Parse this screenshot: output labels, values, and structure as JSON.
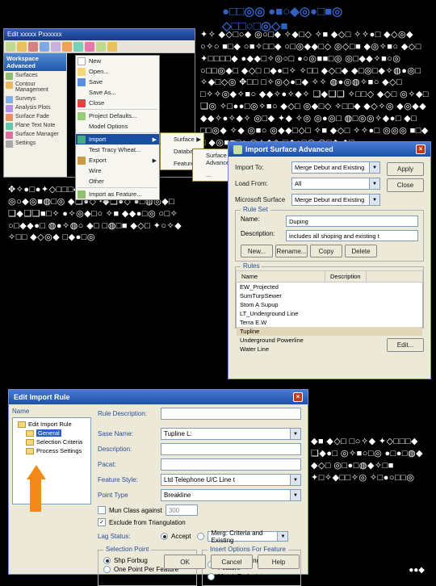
{
  "title_line1": "●□□◎◎ ●■○◆◎●□■◎",
  "title_line2": "◇□□○□◎◇■",
  "para1": "✦✧ ◆◇□○◆ ◎○□◆ ✧◆□◇ ✧■ ◆◇□ ✧✧●□ ◆◇◎◆ ○✧○ ■□◆ ○■✧□□◆ ○□◎◆◆□◇ ◎◇□■ ◆◎✧■○ ◆◇□ ✦□□□□◆ ●◆◆□✧◎○□ ●○◎■■□◎ ◎□◆◆✧■○◎ ○□□◎◆□ ◆◇□ □◆●□✧ ✧□□ ◆◇□◆ ◆□◎□◆✧◍●◎□ ✧◆□◇◎ ✥□□ □✧◎◇●□◆ ✧✧ ◍●◎◍✧■○ ◆◇□ □✧✧◎◆✧■○ ◆◆✧●✧◆✧ ❑◆❑❑ ✧□□◇ ◆◇□ ◎✧◆□ ❑◎ ✧□●●□◎✧■○ ◆◇□ ◎◆□◇ ✧□□◆ ◆◇✧◎ ◆◎◆◆ ◆◆✧●✧◆✧ ◎□◆ ✦◆ ✧◎ ◎●◎□ ◍□◎◎✧◆●□ ◆□ □□◎◆ ✧◆ ◎■○ ◎◆◆□◇□ ✧■ ◆◇□ ✧✧●□ ◎◎◎ ■□◆ □ ◆◎■■□○ ◎✧◆◇ □◆●□◎ ◎□◆ ◆□",
  "para2": "✥✧●□●✦◇□□□◆●◎◆◆□✧◎○□ ◎○◆◎■◍□◎ ◆❑●◇ •◆❑●◇ ●□◍◎◆□ ❑◆❑❑■□✧ ●✧◎◆□○ ✧■ ◆◆●□◎ ○□✧ ○□◆◆●□ ◍●✧◍○ ◆□ □◍□■ ◆◇□ ✦○✧◆ ✧□□ ◆◇◎◆ □◆●□◎",
  "para3": "◆■ ◆◇□ □○✧◆ ✦◇□□□◆ ❑◆●□ ◎✧■○□◎ ●□●□◍◆ ◆◇□ ◎□●□◍◆✧□■ ✦□✧◆□□✧◎ ✧□●○□□◎",
  "pagenum": "●●◆",
  "s1": {
    "title": "Edit xxxxx Pxxxxxx",
    "tasks_header": "Workspace Advanced",
    "sidebar_items": [
      "Surfaces",
      "Contour Management",
      "Surveys",
      "Analysis Plots",
      "Surface Fade",
      "Plane Text Note",
      "Surface Manager",
      "Settings"
    ],
    "menu_items": [
      "New",
      "Open...",
      "Save",
      "Save As...",
      "Close",
      "Project Defaults...",
      "Model Options",
      "Import",
      "Test Tracy Wheat...",
      "Export",
      "Wire",
      "Other"
    ],
    "menu_last": "Import as Feature...",
    "submenu": [
      "Surface",
      "Database",
      "Feature"
    ],
    "subsubmenu": [
      "Surface Advanced...",
      "..."
    ]
  },
  "s2": {
    "title": "Import Surface Advanced",
    "lbl_importto": "Import To:",
    "val_importto": "Merge Debut and Existing",
    "lbl_loadfrom": "Load From:",
    "val_loadfrom": "All",
    "lbl_micesurf": "Microsoft Surface",
    "val_micesurf": "Merge Debut and Existing",
    "btn_apply": "Apply",
    "btn_close": "Close",
    "group_ruleset": "Rule Set",
    "lbl_name": "Name:",
    "val_name": "Duping",
    "lbl_desc": "Description:",
    "val_desc": "includes all shoping and existing t",
    "btn_new": "New...",
    "btn_rename": "Rename...",
    "btn_copy": "Copy",
    "btn_delete": "Delete",
    "group_rules": "Rules",
    "col_name": "Name",
    "col_desc": "Description",
    "rules": [
      "EW_Projected",
      "SumTurpSewer",
      "Stom A Supup",
      "LT_Underground Line",
      "Terra E.W",
      "Tupline",
      "Underground Powerline",
      "Water Line"
    ],
    "btn_edit": "Edit..."
  },
  "s3": {
    "title": "Edit Import Rule",
    "lbl_name": "Name",
    "tree": {
      "root": "Edit Import Rule",
      "n1": "General",
      "n2": "Selection Criteria",
      "n3": "Process Settings"
    },
    "lbl_ruledesc": "Rule Description:",
    "lbl_sasename": "Sase Name:",
    "val_sasename": "Tupline L:",
    "lbl_description": "Description:",
    "lbl_pacat": "Pacat:",
    "lbl_featstyle": "Feature Style:",
    "val_featstyle": "Ltd Telephone U/C Line t",
    "lbl_pointtype": "Point Type",
    "val_pointtype": "Breakline",
    "cb_munclass": "Mun Class against",
    "val_munclass": "300",
    "cb_exclude": "Exclude from Triangulation",
    "lbl_lagstatus": "Lag Status:",
    "r1": "Accept",
    "r2": "Merg: Criteria and Existing",
    "group_select": "Selection Point",
    "r3": "Shp Forbug",
    "r4": "One Point Per Feature",
    "group_insert": "Insert Options For Feature",
    "r5": "One Linestring For Feature",
    "r6": "Match Endpoints",
    "btn_ok": "OK",
    "btn_cancel": "Cancel",
    "btn_help": "Help"
  }
}
